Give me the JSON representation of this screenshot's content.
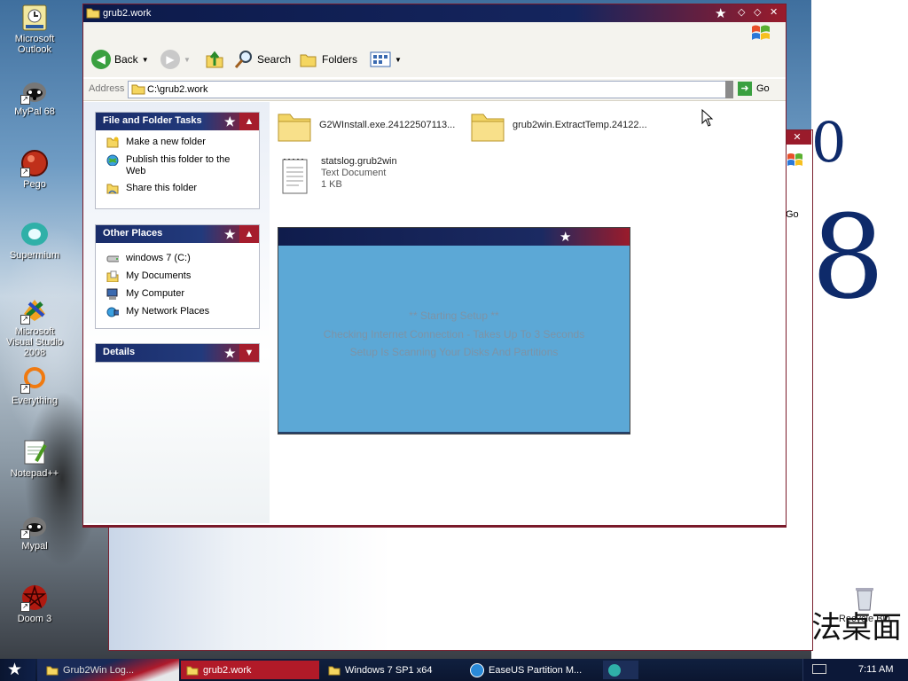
{
  "desktop": {
    "icons": [
      {
        "label": "Microsoft Outlook"
      },
      {
        "label": "MyPal 68"
      },
      {
        "label": "Pego"
      },
      {
        "label": "Supermium"
      },
      {
        "label": "Microsoft Visual Studio 2008"
      },
      {
        "label": "Everything"
      },
      {
        "label": "Notepad++"
      },
      {
        "label": "Mypal"
      },
      {
        "label": "Doom 3"
      }
    ],
    "recycle_bin": "Recycle Bin",
    "wallpaper_chars": "法桌面",
    "back_window_go": "Go",
    "digit_8": "8",
    "digit_0": "0"
  },
  "window": {
    "title": "grub2.work",
    "toolbar": {
      "back": "Back",
      "search": "Search",
      "folders": "Folders"
    },
    "address": {
      "label": "Address",
      "value": "C:\\grub2.work",
      "go": "Go"
    }
  },
  "sidepane": {
    "file_tasks": {
      "title": "File and Folder Tasks",
      "items": [
        {
          "label": "Make a new folder"
        },
        {
          "label": "Publish this folder to the Web"
        },
        {
          "label": "Share this folder"
        }
      ]
    },
    "other_places": {
      "title": "Other Places",
      "items": [
        {
          "label": "windows 7 (C:)"
        },
        {
          "label": "My Documents"
        },
        {
          "label": "My Computer"
        },
        {
          "label": "My Network Places"
        }
      ]
    },
    "details": {
      "title": "Details"
    }
  },
  "files": [
    {
      "name": "G2WInstall.exe.24122507113..."
    },
    {
      "name": "grub2win.ExtractTemp.24122..."
    },
    {
      "name": "statslog.grub2win",
      "type": "Text Document",
      "size": "1 KB"
    }
  ],
  "setup_dialog": {
    "lines": [
      "** Starting Setup **",
      "Checking Internet Connection - Takes Up To 3 Seconds",
      "Setup Is Scanning Your Disks And Partitions"
    ]
  },
  "taskbar": {
    "tasks": [
      {
        "label": "Grub2Win Log..."
      },
      {
        "label": "grub2.work"
      },
      {
        "label": "Windows 7 SP1 x64"
      },
      {
        "label": "EaseUS Partition M..."
      }
    ],
    "clock": "7:11 AM"
  },
  "colors": {
    "title_navy": "#15255e",
    "flag_red": "#9a1b2b",
    "setup_blue": "#5ca8d6"
  }
}
